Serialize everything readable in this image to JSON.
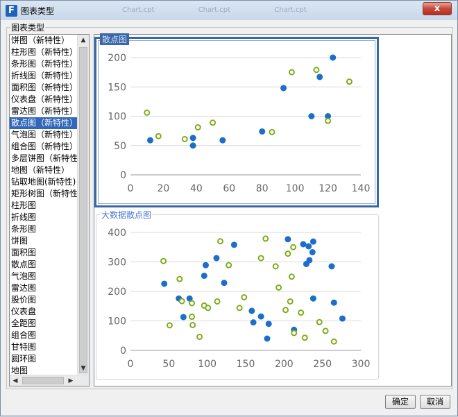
{
  "window": {
    "title": "图表类型",
    "bg_tabs": [
      "Chart.cpt",
      "Chart.cpt",
      "Chart.cpt"
    ],
    "close_label": "x"
  },
  "fieldset_label": "图表类型",
  "list": {
    "selected_index": 7,
    "items": [
      "饼图（新特性）",
      "柱形图（新特性）",
      "条形图（新特性）",
      "折线图（新特性）",
      "面积图（新特性）",
      "仪表盘（新特性）",
      "雷达图（新特性）",
      "散点图（新特性）",
      "气泡图（新特性）",
      "组合图（新特性）",
      "多层饼图（新特性",
      "地图（新特性）",
      "钻取地图(新特性)",
      "矩形树图（新特性",
      "柱形图",
      "折线图",
      "条形图",
      "饼图",
      "面积图",
      "散点图",
      "气泡图",
      "雷达图",
      "股价图",
      "仪表盘",
      "全距图",
      "组合图",
      "甘特图",
      "圆环图",
      "地图"
    ]
  },
  "colors": {
    "blue": "#1c6ec9",
    "green": "#7fac1c",
    "axis": "#666666",
    "grid": "#d8d8d8",
    "selected": "#3166b8"
  },
  "chart_data": [
    {
      "type": "scatter",
      "title": "散点图",
      "xlim": [
        0,
        140
      ],
      "ylim": [
        0,
        200
      ],
      "xticks": [
        0,
        20,
        40,
        60,
        80,
        100,
        120,
        140
      ],
      "yticks": [
        0,
        50,
        100,
        150,
        200
      ],
      "series": [
        {
          "values": [
            [
              12,
              59
            ],
            [
              38,
              50
            ],
            [
              38,
              63
            ],
            [
              56,
              59
            ],
            [
              80,
              74
            ],
            [
              93,
              148
            ],
            [
              110,
              100
            ],
            [
              115,
              167
            ],
            [
              120,
              100
            ],
            [
              123,
              200
            ]
          ]
        },
        {
          "values": [
            [
              10,
              106
            ],
            [
              17,
              66
            ],
            [
              33,
              61
            ],
            [
              41,
              81
            ],
            [
              50,
              89
            ],
            [
              86,
              73
            ],
            [
              98,
              175
            ],
            [
              113,
              179
            ],
            [
              120,
              92
            ],
            [
              133,
              159
            ]
          ]
        }
      ]
    },
    {
      "type": "scatter",
      "title": "大数据散点图",
      "xlim": [
        0,
        300
      ],
      "ylim": [
        0,
        400
      ],
      "xticks": [
        0,
        50,
        100,
        150,
        200,
        250,
        300
      ],
      "yticks": [
        0,
        100,
        200,
        300,
        400
      ],
      "series": [
        {
          "values": [
            [
              44,
              226
            ],
            [
              63,
              176
            ],
            [
              69,
              113
            ],
            [
              77,
              176
            ],
            [
              96,
              253
            ],
            [
              98,
              289
            ],
            [
              112,
              313
            ],
            [
              122,
              229
            ],
            [
              135,
              358
            ],
            [
              158,
              134
            ],
            [
              160,
              95
            ],
            [
              170,
              115
            ],
            [
              178,
              40
            ],
            [
              180,
              90
            ],
            [
              205,
              377
            ],
            [
              213,
              70
            ],
            [
              225,
              360
            ],
            [
              229,
              293
            ],
            [
              232,
              353
            ],
            [
              233,
              306
            ],
            [
              237,
              333
            ],
            [
              238,
              369
            ],
            [
              238,
              176
            ],
            [
              262,
              285
            ],
            [
              265,
              162
            ],
            [
              276,
              108
            ]
          ]
        },
        {
          "values": [
            [
              43,
              303
            ],
            [
              51,
              85
            ],
            [
              64,
              242
            ],
            [
              67,
              167
            ],
            [
              80,
              160
            ],
            [
              80,
              114
            ],
            [
              81,
              86
            ],
            [
              90,
              46
            ],
            [
              96,
              152
            ],
            [
              101,
              144
            ],
            [
              113,
              166
            ],
            [
              117,
              370
            ],
            [
              128,
              289
            ],
            [
              142,
              144
            ],
            [
              148,
              180
            ],
            [
              170,
              313
            ],
            [
              176,
              379
            ],
            [
              189,
              285
            ],
            [
              193,
              213
            ],
            [
              202,
              137
            ],
            [
              205,
              328
            ],
            [
              208,
              166
            ],
            [
              210,
              250
            ],
            [
              212,
              350
            ],
            [
              213,
              59
            ],
            [
              222,
              128
            ],
            [
              227,
              43
            ],
            [
              246,
              96
            ],
            [
              254,
              66
            ],
            [
              265,
              30
            ]
          ]
        }
      ]
    }
  ],
  "buttons": {
    "ok": "确定",
    "cancel": "取消"
  }
}
